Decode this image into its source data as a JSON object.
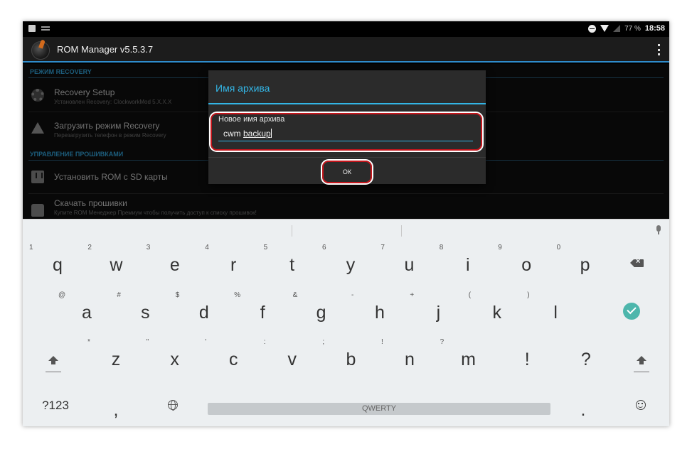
{
  "status_bar": {
    "battery": "77 %",
    "time": "18:58"
  },
  "app": {
    "title": "ROM Manager v5.5.3.7"
  },
  "sections": [
    {
      "header": "Режим Recovery"
    },
    {
      "header": "Управление прошивками"
    }
  ],
  "list_items": [
    {
      "title": "Recovery Setup",
      "subtitle": "Установлен Recovery: ClockworkMod 5.X.X.X"
    },
    {
      "title": "Загрузить режим Recovery",
      "subtitle": "Перезагрузить телефон в режим Recovery"
    },
    {
      "title": "Установить ROM с SD карты",
      "subtitle": ""
    },
    {
      "title": "Скачать прошивки",
      "subtitle": "Купите ROM Менеджер Премиум чтобы получить доступ к списку прошивок!"
    }
  ],
  "dialog": {
    "title": "Имя архива",
    "field_label": "Новое имя архива",
    "input_prefix": "cwm ",
    "input_underlined": "backup",
    "ok_label": "ОК"
  },
  "keyboard": {
    "row1": [
      {
        "key": "q",
        "hint": "1"
      },
      {
        "key": "w",
        "hint": "2"
      },
      {
        "key": "e",
        "hint": "3"
      },
      {
        "key": "r",
        "hint": "4"
      },
      {
        "key": "t",
        "hint": "5"
      },
      {
        "key": "y",
        "hint": "6"
      },
      {
        "key": "u",
        "hint": "7"
      },
      {
        "key": "i",
        "hint": "8"
      },
      {
        "key": "o",
        "hint": "9"
      },
      {
        "key": "p",
        "hint": "0"
      }
    ],
    "row2": [
      {
        "key": "a",
        "hint": "@"
      },
      {
        "key": "s",
        "hint": "#"
      },
      {
        "key": "d",
        "hint": "$"
      },
      {
        "key": "f",
        "hint": "%"
      },
      {
        "key": "g",
        "hint": "&"
      },
      {
        "key": "h",
        "hint": "-"
      },
      {
        "key": "j",
        "hint": "+"
      },
      {
        "key": "k",
        "hint": "("
      },
      {
        "key": "l",
        "hint": ")"
      }
    ],
    "row3": [
      {
        "key": "z",
        "hint": "*"
      },
      {
        "key": "x",
        "hint": "\""
      },
      {
        "key": "c",
        "hint": "'"
      },
      {
        "key": "v",
        "hint": ":"
      },
      {
        "key": "b",
        "hint": ";"
      },
      {
        "key": "n",
        "hint": "!"
      },
      {
        "key": "m",
        "hint": "?"
      },
      {
        "key": "!",
        "hint": ""
      },
      {
        "key": "?",
        "hint": ""
      }
    ],
    "symbols_label": "?123",
    "comma_label": ",",
    "space_label": "QWERTY",
    "period_label": "."
  },
  "colors": {
    "accent": "#33b5e5",
    "highlight": "#c4161c",
    "enter": "#4db6ac"
  }
}
